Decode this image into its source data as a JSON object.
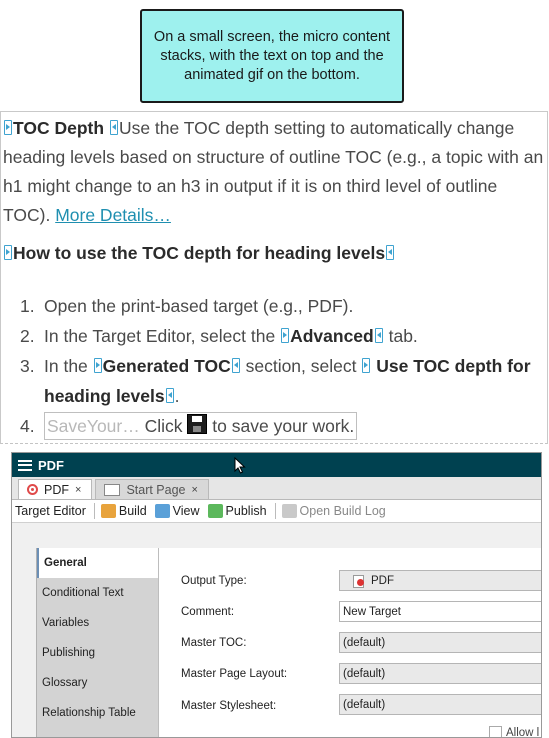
{
  "callout": {
    "text": "On a small screen, the micro content stacks, with the text on top and the animated gif on the bottom."
  },
  "intro": {
    "term": "TOC Depth",
    "body": "Use the TOC depth setting to automatically change heading levels based on structure of outline TOC (e.g., a topic with an h1 might change to an h3 in output if it is on third level of outline TOC).",
    "link": "More Details…"
  },
  "heading": "How to use the TOC depth for heading levels",
  "steps": {
    "s1": {
      "num": "1.",
      "text": "Open the print-based target (e.g., PDF)."
    },
    "s2": {
      "num": "2.",
      "pre": "In the Target Editor, select the",
      "bold": "Advanced",
      "post": "tab."
    },
    "s3": {
      "num": "3.",
      "pre": "In the",
      "bold1": "Generated TOC",
      "mid": "section, select",
      "bold2": "Use TOC depth for heading levels",
      "post": "."
    },
    "s4": {
      "num": "4.",
      "snippet": "SaveYour…",
      "pre": "Click",
      "post": "to save your work."
    }
  },
  "app": {
    "title": "PDF",
    "tabs": [
      {
        "label": "PDF",
        "close": "×"
      },
      {
        "label": "Start Page",
        "close": "×"
      }
    ],
    "toolbar": {
      "editor_label": "Target Editor",
      "build": "Build",
      "view": "View",
      "publish": "Publish",
      "open_log": "Open Build Log"
    },
    "side_items": [
      "General",
      "Conditional Text",
      "Variables",
      "Publishing",
      "Glossary",
      "Relationship Table"
    ],
    "fields": {
      "output_type_label": "Output Type:",
      "output_type_value": "PDF",
      "comment_label": "Comment:",
      "comment_value": "New Target",
      "master_toc_label": "Master TOC:",
      "master_toc_value": "(default)",
      "master_page_label": "Master Page Layout:",
      "master_page_value": "(default)",
      "master_style_label": "Master Stylesheet:",
      "master_style_value": "(default)",
      "allow_label": "Allow l"
    },
    "colors": {
      "titlebar": "#004150",
      "callout": "#9ef1ee",
      "tag": "#3fa3d0"
    }
  }
}
